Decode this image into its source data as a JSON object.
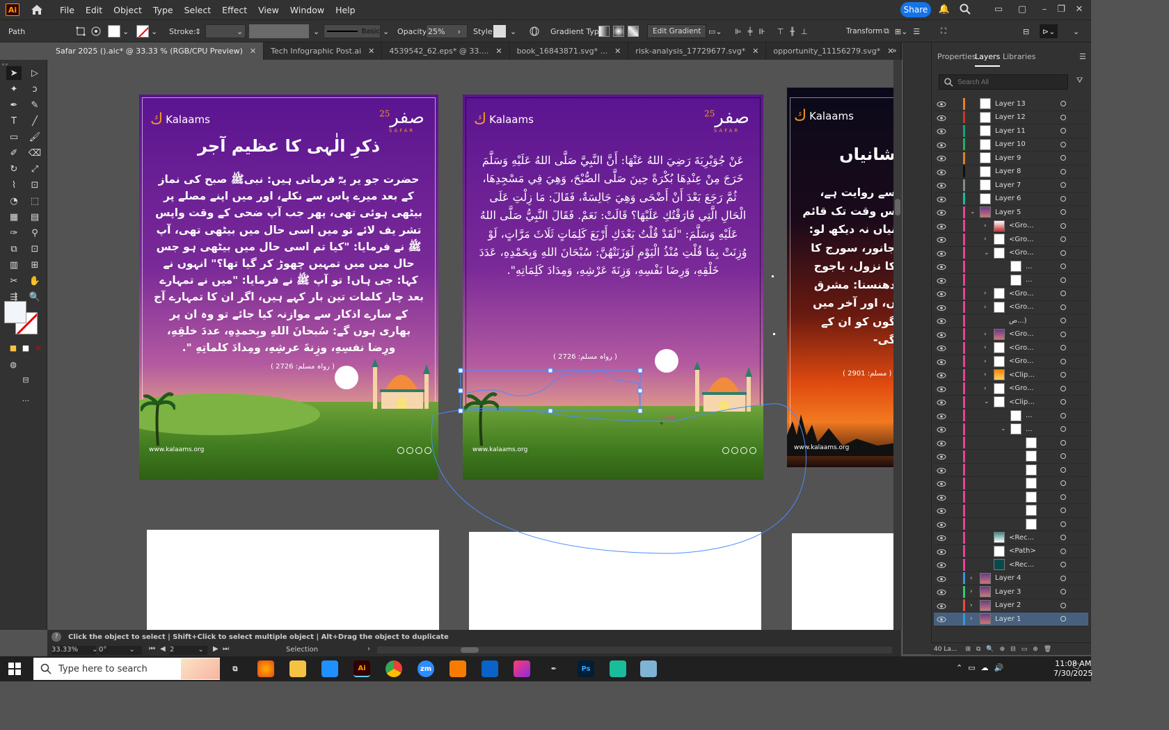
{
  "app": {
    "logo": "Ai",
    "menus": [
      "File",
      "Edit",
      "Object",
      "Type",
      "Select",
      "Effect",
      "View",
      "Window",
      "Help"
    ],
    "share": "Share"
  },
  "control": {
    "object": "Path",
    "stroke_label": "Stroke:",
    "brush": "Basic",
    "opacity_label": "Opacity:",
    "opacity": "25%",
    "style_label": "Style:",
    "gradient_label": "Gradient Type:",
    "edit_gradient": "Edit Gradient",
    "transform": "Transform"
  },
  "tabs": [
    {
      "label": "Safar 2025 ().aic* @ 33.33 % (RGB/CPU Preview)",
      "active": true
    },
    {
      "label": "Tech Infographic Post.ai"
    },
    {
      "label": "4539542_62.eps* @ 33...."
    },
    {
      "label": "book_16843871.svg* ..."
    },
    {
      "label": "risk-analysis_17729677.svg*"
    },
    {
      "label": "opportunity_11156279.svg*"
    },
    {
      "label": "knowledge-managem"
    }
  ],
  "panel": {
    "tabs": [
      "Properties",
      "Layers",
      "Libraries"
    ],
    "search_placeholder": "Search All",
    "layer_count": "40 La..."
  },
  "layers": [
    {
      "name": "Layer 13",
      "indent": 0,
      "color": "#e67e22",
      "thumb": "white",
      "arrow": ""
    },
    {
      "name": "Layer 12",
      "indent": 0,
      "color": "#c0392b",
      "thumb": "white",
      "arrow": ""
    },
    {
      "name": "Layer 11",
      "indent": 0,
      "color": "#16a085",
      "thumb": "white",
      "arrow": ""
    },
    {
      "name": "Layer 10",
      "indent": 0,
      "color": "#27ae60",
      "thumb": "white",
      "arrow": ""
    },
    {
      "name": "Layer 9",
      "indent": 0,
      "color": "#e67e22",
      "thumb": "white",
      "arrow": ""
    },
    {
      "name": "Layer 8",
      "indent": 0,
      "color": "#111111",
      "thumb": "white",
      "arrow": ""
    },
    {
      "name": "Layer 7",
      "indent": 0,
      "color": "#7f8c8d",
      "thumb": "white",
      "arrow": ""
    },
    {
      "name": "Layer 6",
      "indent": 0,
      "color": "#1abc9c",
      "thumb": "white",
      "arrow": ""
    },
    {
      "name": "Layer 5",
      "indent": 0,
      "color": "#e84393",
      "thumb": "art",
      "arrow": "v"
    },
    {
      "name": "<Gro...",
      "indent": 1,
      "color": "#e84393",
      "thumb": "red",
      "arrow": ">"
    },
    {
      "name": "<Gro...",
      "indent": 1,
      "color": "#e84393",
      "thumb": "white",
      "arrow": ">"
    },
    {
      "name": "<Gro...",
      "indent": 1,
      "color": "#e84393",
      "thumb": "white",
      "arrow": "v"
    },
    {
      "name": "...",
      "indent": 2,
      "color": "#e84393",
      "thumb": "white",
      "arrow": ""
    },
    {
      "name": "...",
      "indent": 2,
      "color": "#e84393",
      "thumb": "line",
      "arrow": ""
    },
    {
      "name": "<Gro...",
      "indent": 1,
      "color": "#e84393",
      "thumb": "white",
      "arrow": ">"
    },
    {
      "name": "<Gro...",
      "indent": 1,
      "color": "#e84393",
      "thumb": "white",
      "arrow": ">"
    },
    {
      "name": "ص...)",
      "indent": 1,
      "color": "#e84393",
      "thumb": "none",
      "arrow": ""
    },
    {
      "name": "<Gro...",
      "indent": 1,
      "color": "#e84393",
      "thumb": "art",
      "arrow": ">"
    },
    {
      "name": "<Gro...",
      "indent": 1,
      "color": "#e84393",
      "thumb": "white",
      "arrow": ">"
    },
    {
      "name": "<Gro...",
      "indent": 1,
      "color": "#e84393",
      "thumb": "white",
      "arrow": ">"
    },
    {
      "name": "<Clip...",
      "indent": 1,
      "color": "#e84393",
      "thumb": "orange",
      "arrow": ">"
    },
    {
      "name": "<Gro...",
      "indent": 1,
      "color": "#e84393",
      "thumb": "white",
      "arrow": ">"
    },
    {
      "name": "<Clip...",
      "indent": 1,
      "color": "#e84393",
      "thumb": "white",
      "arrow": "v"
    },
    {
      "name": "...",
      "indent": 2,
      "color": "#e84393",
      "thumb": "white",
      "arrow": ""
    },
    {
      "name": "...",
      "indent": 2,
      "color": "#e84393",
      "thumb": "white",
      "arrow": "v"
    },
    {
      "name": "",
      "indent": 3,
      "color": "#e84393",
      "thumb": "white",
      "arrow": ""
    },
    {
      "name": "",
      "indent": 3,
      "color": "#e84393",
      "thumb": "white",
      "arrow": ""
    },
    {
      "name": "",
      "indent": 3,
      "color": "#e84393",
      "thumb": "white",
      "arrow": ""
    },
    {
      "name": "",
      "indent": 3,
      "color": "#e84393",
      "thumb": "white",
      "arrow": ""
    },
    {
      "name": "",
      "indent": 3,
      "color": "#e84393",
      "thumb": "white",
      "arrow": ""
    },
    {
      "name": "",
      "indent": 3,
      "color": "#e84393",
      "thumb": "white",
      "arrow": ""
    },
    {
      "name": "",
      "indent": 3,
      "color": "#e84393",
      "thumb": "white",
      "arrow": ""
    },
    {
      "name": "<Rec...",
      "indent": 1,
      "color": "#e84393",
      "thumb": "teal",
      "arrow": ""
    },
    {
      "name": "<Path>",
      "indent": 1,
      "color": "#e84393",
      "thumb": "white",
      "arrow": ""
    },
    {
      "name": "<Rec...",
      "indent": 1,
      "color": "#e84393",
      "thumb": "dark",
      "arrow": ""
    },
    {
      "name": "Layer 4",
      "indent": 0,
      "color": "#3498db",
      "thumb": "art",
      "arrow": ">"
    },
    {
      "name": "Layer 3",
      "indent": 0,
      "color": "#2ecc71",
      "thumb": "art",
      "arrow": ">"
    },
    {
      "name": "Layer 2",
      "indent": 0,
      "color": "#e74c3c",
      "thumb": "art",
      "arrow": ">"
    },
    {
      "name": "Layer 1",
      "indent": 0,
      "color": "#3498db",
      "thumb": "art",
      "arrow": ">",
      "selected": true
    }
  ],
  "poster1": {
    "brand": "Kalaams",
    "safar": "صفر",
    "safar_num": "25",
    "safar_sub": "SAFAR",
    "title": "ذکرِ الٰہی کا عظیم آجر",
    "body": "حضرت جو یر یہؓ فرماتی ہیں: نبیﷺ صبح کی نماز کے بعد میرے پاس سے نکلے، اور میں اپنے مصلے پر بیٹھی ہوئی تھی، پھر جب آپ ضحی کے وقت واپس تشر یف لائے تو میں اسی حال میں بیٹھی تھی، آپ ﷺ نے فرمایا: \"کیا تم اسی حال میں بیٹھی ہو جس حال میں میں تمہیں چھوڑ کر گیا تھا؟\" انہوں نے کہا: جی ہاں! تو آپ ﷺ نے فرمایا: \"میں نے تمہارے بعد چار کلمات تین بار کہے ہیں، اگر ان کا تمہارے آج کے سارے اذکار سے موازنہ کیا جائے تو وہ ان پر بھاری ہوں گے: سُبحانَ اللهِ وبِحمدِهِ، عددَ خلقِهِ، ورِضا نفسِهِ، وزِنةَ عرشِهِ، ومِدادَ كلماتِهِ \".",
    "ref": "( رواہ مسلم: 2726 )",
    "url": "www.kalaams.org"
  },
  "poster2": {
    "brand": "Kalaams",
    "safar": "صفر",
    "safar_num": "25",
    "safar_sub": "SAFAR",
    "body": "عَنْ جُوَيْرِيَةَ رَضِيَ اللهُ عَنْهَا: أَنَّ النَّبِيَّ صَلَّى اللهُ عَلَيْهِ وَسَلَّمَ خَرَجَ مِنْ عِنْدِهَا بُكْرَةً حِينَ صَلَّى الصُّبْحَ، وَهِيَ فِي مَسْجِدِهَا، ثُمَّ رَجَعَ بَعْدَ أَنْ أَضْحَى وَهِيَ جَالِسَةٌ، فَقَالَ: مَا زِلْتِ عَلَى الْحَالِ الَّتِي فَارَقْتُكِ عَلَيْهَا؟ قَالَتْ: نَعَمْ. فَقَالَ النَّبِيُّ صَلَّى اللهُ عَلَيْهِ وَسَلَّمَ: \"لَقَدْ قُلْتُ بَعْدَكِ أَرْبَعَ كَلِمَاتٍ ثَلَاثَ مَرَّاتٍ، لَوْ وُزِنَتْ بِمَا قُلْتِ مُنْذُ الْيَوْمِ لَوَزَنَتْهُنَّ: سُبْحَانَ اللهِ وَبِحَمْدِهِ، عَدَدَ خَلْقِهِ، وَرِضَا نَفْسِهِ، وَزِنَةَ عَرْشِهِ، وَمِدَادَ كَلِمَاتِهِ\".",
    "ref": "( رواہ مسلم: 2726 )",
    "url": "www.kalaams.org",
    "path_label": "path"
  },
  "poster3": {
    "brand": "Kalaams",
    "title": "شانیاں",
    "lines": [
      "سے روایت ہے،",
      "س وقت تک قائم",
      "نیاں نہ دیکھ لو:",
      "جانور، سورج کا",
      "کا نزول، یاجوج",
      "دھنسنا: مشرق",
      "ں، اور آخر میں",
      "گوں کو ان کے",
      "گی-"
    ],
    "ref": "( مسلم: 2901 )",
    "url": "www.kalaams.org"
  },
  "status": {
    "hint": "Click the object to select  |  Shift+Click to select multiple object  |  Alt+Drag the object to duplicate",
    "zoom": "33.33%",
    "rotate": "0°",
    "artboard": "2",
    "mode": "Selection"
  },
  "taskbar": {
    "search": "Type here to search",
    "time": "11:08 AM",
    "date": "7/30/2025"
  }
}
